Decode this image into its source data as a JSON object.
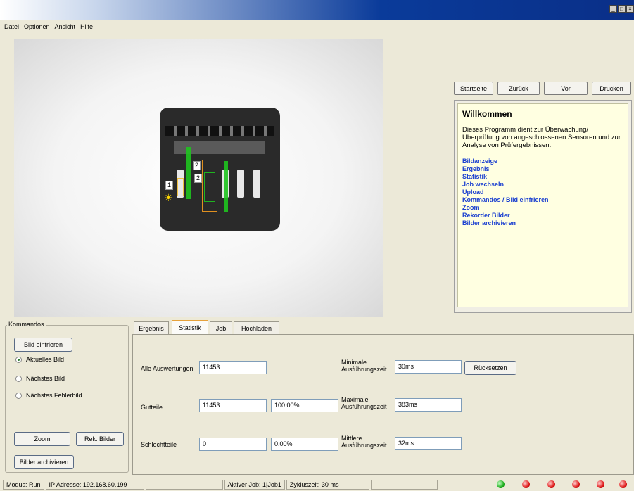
{
  "window": {
    "controls": [
      "_",
      "□",
      "×"
    ]
  },
  "menu": [
    "Datei",
    "Optionen",
    "Ansicht",
    "Hilfe"
  ],
  "image": {
    "tag1": "1",
    "tag2a": "2",
    "tag2b": "2"
  },
  "nav": {
    "home": "Startseite",
    "back": "Zurück",
    "forward": "Vor",
    "print": "Drucken"
  },
  "help": {
    "title": "Willkommen",
    "text": "Dieses Programm dient zur Überwachung/Überprüfung von angeschlossenen Sensoren und zur Analyse von Prüfergebnissen.",
    "links": [
      "Bildanzeige",
      "Ergebnis",
      "Statistik",
      "Job wechseln",
      "Upload",
      "Kommandos / Bild einfrieren",
      "Zoom",
      "Rekorder Bilder",
      "Bilder archivieren"
    ]
  },
  "commands": {
    "legend": "Kommandos",
    "freeze": "Bild einfrieren",
    "radios": [
      "Aktuelles Bild",
      "Nächstes Bild",
      "Nächstes Fehlerbild"
    ],
    "selected_radio": "Aktuelles Bild",
    "zoom": "Zoom",
    "rec_images": "Rek. Bilder",
    "archive": "Bilder archivieren"
  },
  "tabs": [
    "Ergebnis",
    "Statistik",
    "Job",
    "Hochladen"
  ],
  "active_tab": "Statistik",
  "stats": {
    "all_label": "Alle Auswertungen",
    "all_value": "11453",
    "good_label": "Gutteile",
    "good_value": "11453",
    "good_pct": "100.00%",
    "bad_label": "Schlechtteile",
    "bad_value": "0",
    "bad_pct": "0.00%",
    "min_label_1": "Minimale",
    "min_label_2": "Ausführungszeit",
    "min_value": "30ms",
    "max_label_1": "Maximale",
    "max_label_2": "Ausführungszeit",
    "max_value": "383ms",
    "avg_label_1": "Mittlere",
    "avg_label_2": "Ausführungszeit",
    "avg_value": "32ms",
    "reset": "Rücksetzen"
  },
  "status": {
    "mode": "Modus: Run",
    "ip": "IP Adresse: 192.168.60.199",
    "job": "Aktiver Job: 1|Job1",
    "cycle": "Zykluszeit: 30 ms",
    "leds": [
      "green",
      "red",
      "red",
      "red",
      "red",
      "red"
    ]
  }
}
